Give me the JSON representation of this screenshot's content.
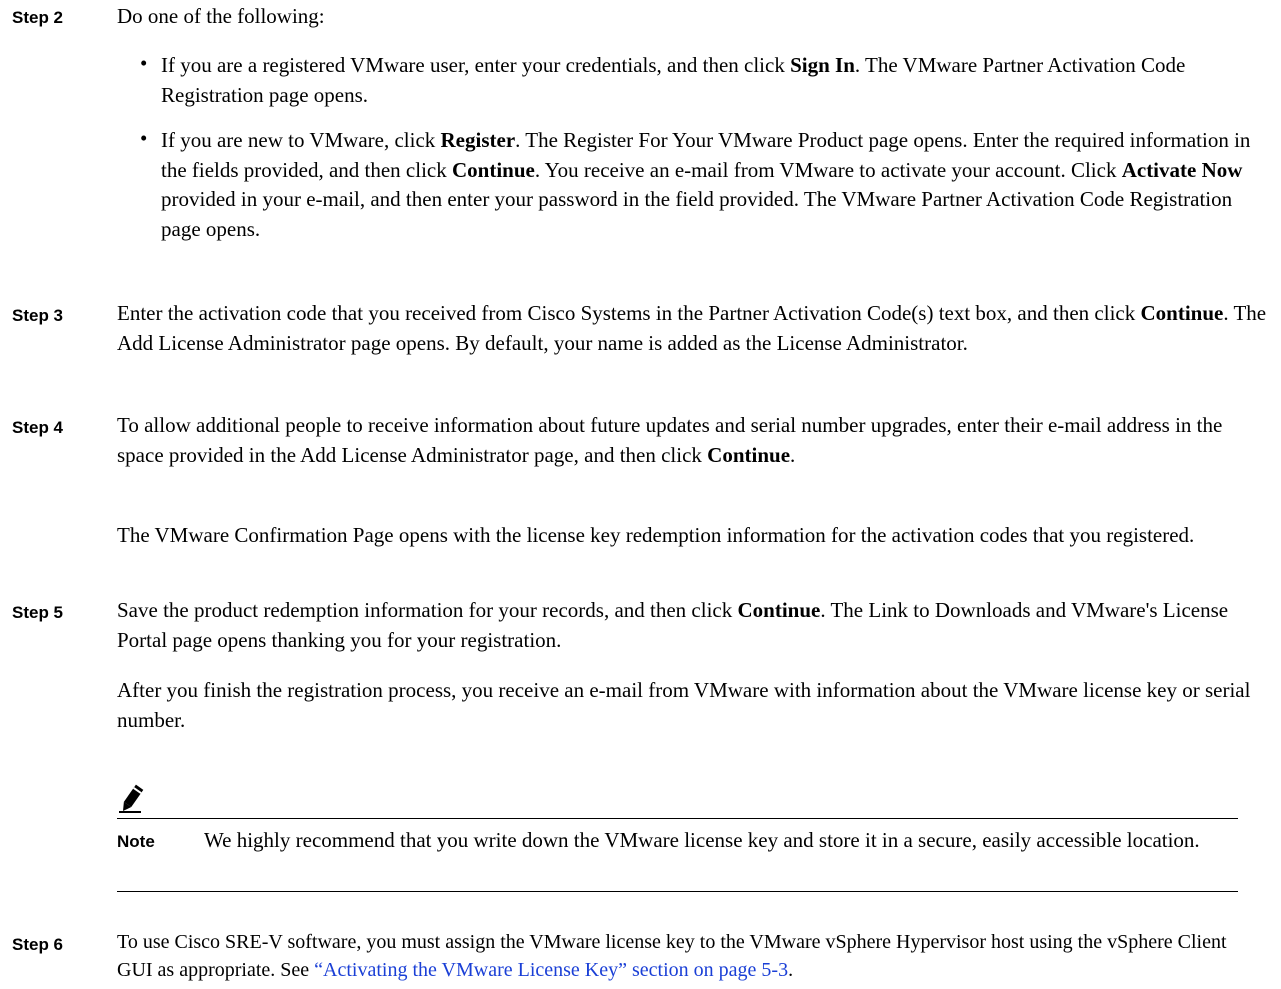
{
  "steps": {
    "step2": {
      "label": "Step 2",
      "intro": "Do one of the following:",
      "bullet1": {
        "pre": "If you are a registered VMware user, enter your credentials, and then click ",
        "bold1": "Sign In",
        "post": ". The VMware Partner Activation Code Registration page opens."
      },
      "bullet2": {
        "pre": "If you are new to VMware, click ",
        "bold1": "Register",
        "mid1": ". The Register For Your VMware Product page opens. Enter the required information in the fields provided, and then click ",
        "bold2": "Continue",
        "mid2": ". You receive an e-mail from VMware to activate your account. Click ",
        "bold3": "Activate Now",
        "post": " provided in your e-mail, and then enter your password in the field provided. The VMware Partner Activation Code Registration page opens."
      }
    },
    "step3": {
      "label": "Step 3",
      "pre": "Enter the activation code that you received from Cisco Systems in the Partner Activation Code(s) text box, and then click ",
      "bold1": "Continue",
      "post": ". The Add License Administrator page opens. By default, your name is added as the License Administrator."
    },
    "step4": {
      "label": "Step 4",
      "pre": "To allow additional people to receive information about future updates and serial number upgrades, enter their e-mail address in the space provided in the Add License Administrator page, and then click ",
      "bold1": "Continue",
      "post": ".",
      "para2": "The VMware Confirmation Page opens with the license key redemption information for the activation codes that you registered."
    },
    "step5": {
      "label": "Step 5",
      "pre": "Save the product redemption information for your records, and then click ",
      "bold1": "Continue",
      "post": ". The Link to Downloads and VMware's License Portal page opens thanking you for your registration.",
      "para2": "After you finish the registration process, you receive an e-mail from VMware with information about the VMware license key or serial number."
    },
    "note": {
      "label": "Note",
      "text": "We highly recommend that you write down the VMware license key and store it in a secure, easily accessible location."
    },
    "step6": {
      "label": "Step 6",
      "pre": "To use Cisco SRE-V software, you must assign the VMware license key to the VMware vSphere Hypervisor host using the vSphere Client GUI as appropriate. See ",
      "link": "“Activating the VMware License Key” section on page 5-3",
      "post": "."
    }
  }
}
